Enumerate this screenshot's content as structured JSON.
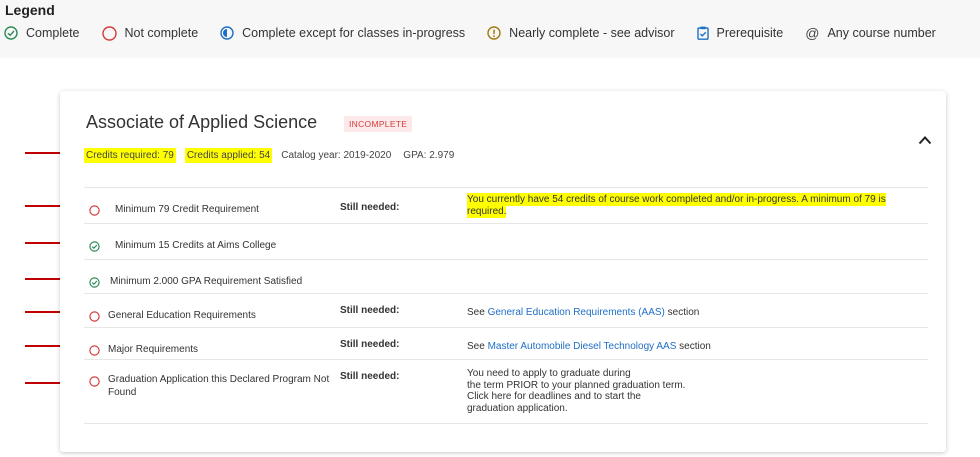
{
  "legend": {
    "title": "Legend",
    "items": [
      {
        "icon": "check-circle-icon",
        "label": "Complete",
        "color": "#2e8b57"
      },
      {
        "icon": "empty-circle-icon",
        "label": "Not complete",
        "color": "#d23c3c"
      },
      {
        "icon": "half-circle-icon",
        "label": "Complete except for classes in-progress",
        "color": "#1f6fc5"
      },
      {
        "icon": "exclamation-circle-icon",
        "label": "Nearly complete - see advisor",
        "color": "#a07a10"
      },
      {
        "icon": "clipboard-check-icon",
        "label": "Prerequisite",
        "color": "#1f6fc5"
      },
      {
        "icon": "at-sign-icon",
        "label": "Any course number",
        "symbol": "@"
      }
    ]
  },
  "card": {
    "title": "Associate of Applied Science",
    "badge": "INCOMPLETE",
    "credits_required": "Credits required:  79",
    "credits_applied": "Credits applied:  54",
    "catalog_year": "Catalog year:  2019-2020",
    "gpa": "GPA:  2.979",
    "requirements": [
      {
        "status": "not-complete",
        "label": "Minimum 79 Credit Requirement",
        "still": "Still needed:",
        "detail": "You currently have 54 credits of course work completed and/or in-progress. A minimum of 79 is required."
      },
      {
        "status": "complete",
        "label": "Minimum 15 Credits at Aims College"
      },
      {
        "status": "complete",
        "label": "Minimum 2.000 GPA Requirement Satisfied"
      },
      {
        "status": "not-complete",
        "label": "General Education Requirements",
        "still": "Still needed:",
        "detail_prefix": "See ",
        "detail_link": "General Education Requirements (AAS)",
        "detail_suffix": " section"
      },
      {
        "status": "not-complete",
        "label": "Major Requirements",
        "still": "Still needed:",
        "detail_prefix": "See ",
        "detail_link": "Master Automobile Diesel Technology AAS",
        "detail_suffix": " section"
      },
      {
        "status": "not-complete",
        "label": "Graduation Application this Declared Program Not Found",
        "still": "Still needed:",
        "detail_lines": [
          "You need to apply to graduate during",
          "the term PRIOR to your planned graduation term.",
          "Click here for deadlines and to start the",
          "graduation application."
        ]
      }
    ]
  },
  "colors": {
    "highlight": "#ffff00",
    "arrow": "#c00000",
    "link": "#1f6fc5",
    "badge_text": "#d23c3c",
    "badge_bg": "#fde9e9"
  }
}
